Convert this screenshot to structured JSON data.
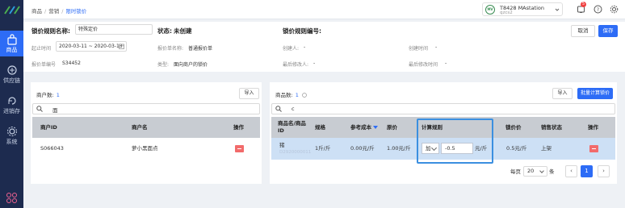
{
  "sidebar": {
    "items": [
      {
        "label": "商品",
        "icon": "shopping-bag-icon"
      },
      {
        "label": "供应链",
        "icon": "supply-chain-icon"
      },
      {
        "label": "进销存",
        "icon": "inventory-icon"
      },
      {
        "label": "系统",
        "icon": "gear-icon"
      }
    ],
    "bottom_label": "..."
  },
  "topbar": {
    "breadcrumbs": [
      "商品",
      "营销",
      "限时锁价"
    ],
    "user": {
      "avatar_text": "MV",
      "name": "T8428 MAstation",
      "sub": "qzcs2"
    },
    "notification_count": "5"
  },
  "header": {
    "rule_name_label": "锁价规则名称:",
    "rule_name_value": "特殊定价",
    "status_label": "状态:",
    "status_value": "未创建",
    "rule_no_label": "锁价规则编号:",
    "rule_no_value": "",
    "cancel_label": "取消",
    "save_label": "保存",
    "fields": {
      "time_label": "起止时间",
      "time_value": "2020-03-11 ~ 2020-03-13",
      "quote_name_label": "报价单名称:",
      "quote_name_value": "普通报价单",
      "creator_label": "创建人:",
      "creator_value": "-",
      "created_time_label": "创建时间",
      "created_time_value": "-",
      "quote_no_label": "报价单编号",
      "quote_no_value": "S34452",
      "type_label": "类型:",
      "type_value": "面向商户的锁价",
      "modifier_label": "最后修改人:",
      "modifier_value": "-",
      "modified_time_label": "最后修改时间",
      "modified_time_value": "-"
    }
  },
  "merchants": {
    "count_label": "商户数:",
    "count": "1",
    "import_label": "导入",
    "search_value": "面",
    "columns": [
      "商户ID",
      "商户名",
      "操作"
    ],
    "rows": [
      {
        "id": "S066043",
        "name": "萝小黑面点"
      }
    ]
  },
  "products": {
    "count_label": "商品数:",
    "count": "1",
    "import_label": "导入",
    "batch_label": "批量计算锁价",
    "search_value": "c",
    "columns": {
      "name": "商品名/商品ID",
      "spec": "规格",
      "ref_cost": "参考成本",
      "orig_price": "原价",
      "calc_rule": "计算规则",
      "lock_price": "锁价价",
      "sale_status": "销售状态",
      "action": "操作"
    },
    "rows": [
      {
        "name": "猪",
        "id": "D2920000011",
        "spec": "1斤/斤",
        "ref_cost": "0.00元/斤",
        "orig_price": "1.00元/斤",
        "calc_op": "加",
        "calc_value": "-0.5",
        "calc_unit": "元/斤",
        "lock_price": "0.5元/斤",
        "sale_status": "上架"
      }
    ],
    "pager": {
      "per_page_label": "每页",
      "per_page": "20",
      "unit": "条",
      "prev": "‹",
      "current": "1",
      "next": "›"
    }
  },
  "colors": {
    "accent": "#2d6cf6",
    "sidebar": "#1d2b4f",
    "danger": "#f26b6b",
    "highlight_border": "#3b8fe0"
  }
}
